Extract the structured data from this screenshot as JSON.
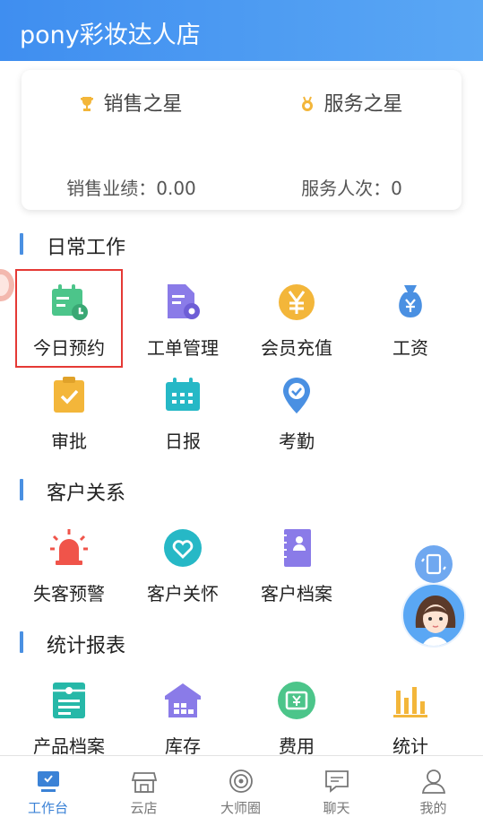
{
  "header": {
    "title": "pony彩妆达人店"
  },
  "stars": {
    "sales": {
      "title": "销售之星",
      "value": "销售业绩：0.00",
      "icon": "trophy-icon"
    },
    "service": {
      "title": "服务之星",
      "value": "服务人次：0",
      "icon": "medal-icon"
    }
  },
  "sections": {
    "daily": {
      "title": "日常工作"
    },
    "customer": {
      "title": "客户关系"
    },
    "reports": {
      "title": "统计报表"
    }
  },
  "daily_items": [
    {
      "label": "今日预约",
      "icon": "calendar-clock-icon",
      "color": "#4cc58a"
    },
    {
      "label": "工单管理",
      "icon": "document-gear-icon",
      "color": "#8a7be8"
    },
    {
      "label": "会员充值",
      "icon": "yen-coin-icon",
      "color": "#f3b63a"
    },
    {
      "label": "工资",
      "icon": "money-bag-icon",
      "color": "#4a90e2"
    },
    {
      "label": "审批",
      "icon": "clipboard-check-icon",
      "color": "#f3b63a"
    },
    {
      "label": "日报",
      "icon": "calendar-grid-icon",
      "color": "#26b8c6"
    },
    {
      "label": "考勤",
      "icon": "location-check-icon",
      "color": "#4a90e2"
    }
  ],
  "customer_items": [
    {
      "label": "失客预警",
      "icon": "alarm-siren-icon",
      "color": "#f0544a"
    },
    {
      "label": "客户关怀",
      "icon": "heart-icon",
      "color": "#26b8c6"
    },
    {
      "label": "客户档案",
      "icon": "notebook-icon",
      "color": "#8a7be8"
    }
  ],
  "report_items": [
    {
      "label": "产品档案",
      "icon": "product-file-icon",
      "color": "#26b8a8"
    },
    {
      "label": "库存",
      "icon": "warehouse-icon",
      "color": "#8a7be8"
    },
    {
      "label": "费用",
      "icon": "yen-ticket-icon",
      "color": "#4cc58a"
    },
    {
      "label": "统计",
      "icon": "bar-chart-icon",
      "color": "#f3b63a"
    }
  ],
  "tabs": [
    {
      "label": "工作台",
      "icon": "desk-icon",
      "active": true
    },
    {
      "label": "云店",
      "icon": "store-icon"
    },
    {
      "label": "大师圈",
      "icon": "circle-icon"
    },
    {
      "label": "聊天",
      "icon": "chat-icon"
    },
    {
      "label": "我的",
      "icon": "person-icon"
    }
  ],
  "colors": {
    "primary": "#3f8ef0",
    "highlight_border": "#e53935",
    "active_tab": "#3b82d6"
  }
}
